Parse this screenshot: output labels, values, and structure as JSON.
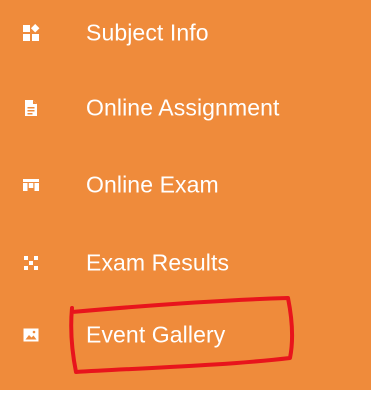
{
  "menu": {
    "background_color": "#ef8b3b",
    "text_color": "#ffffff",
    "items": [
      {
        "label": "Subject Info",
        "icon": "boxes-icon"
      },
      {
        "label": "Online Assignment",
        "icon": "document-icon"
      },
      {
        "label": "Online Exam",
        "icon": "grid-icon"
      },
      {
        "label": "Exam Results",
        "icon": "checker-icon"
      },
      {
        "label": "Event Gallery",
        "icon": "image-icon"
      }
    ]
  },
  "annotation": {
    "stroke_color": "#e8141c",
    "target": "Event Gallery"
  }
}
